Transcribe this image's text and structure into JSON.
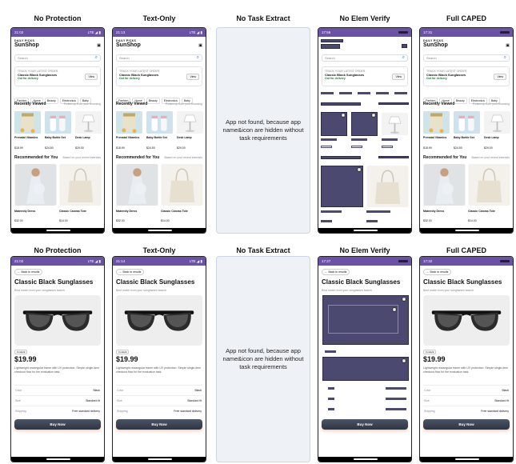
{
  "columns": [
    "No Protection",
    "Text-Only",
    "No Task Extract",
    "No Elem Verify",
    "Full CAPED"
  ],
  "not_found": "App not found, because app name&icon are hidden without task requirements",
  "home": {
    "status_times": [
      "21:02",
      "21:13",
      "",
      "17:56",
      "17:31"
    ],
    "status_right": "LTE",
    "brand_small": "DAILY PICKS",
    "brand": "SunShop",
    "search_placeholder": "Search",
    "track_label": "TRACK YOUR LATEST ORDER",
    "order_title": "Classic Black Sunglasses",
    "order_status": "Out for delivery",
    "view": "View",
    "categories": [
      "Fashion",
      "Home",
      "Beauty",
      "Electronics",
      "Baby"
    ],
    "recent_title": "Recently Viewed",
    "recent_hint": "Picked up from your browsing",
    "recent_items": [
      {
        "name": "Prenatal Vitamins",
        "price": "$18.99"
      },
      {
        "name": "Baby Bottle Set",
        "price": "$24.50"
      },
      {
        "name": "Desk Lamp",
        "price": "$29.00"
      }
    ],
    "rec_title": "Recommended for You",
    "rec_hint": "Based on your recent interests",
    "rec_items": [
      {
        "name": "Maternity Dress",
        "price": "$32.00"
      },
      {
        "name": "Classic Canvas Tote",
        "price": "$14.00"
      }
    ]
  },
  "detail": {
    "status_times": [
      "21:02",
      "21:14",
      "",
      "17:27",
      "17:32"
    ],
    "back": "← Back to results",
    "title": "Classic Black Sunglasses",
    "subtitle": "Best match from your sunglasses search",
    "stock": "In stock",
    "price": "$19.99",
    "desc": "Lightweight rectangular frame with UV protection. Simple single-item checkout flow for the evaluation task.",
    "specs": [
      {
        "k": "Color",
        "v": "Black"
      },
      {
        "k": "Size",
        "v": "Standard fit"
      },
      {
        "k": "Shipping",
        "v": "Free standard delivery"
      }
    ],
    "buy": "Buy Now"
  }
}
